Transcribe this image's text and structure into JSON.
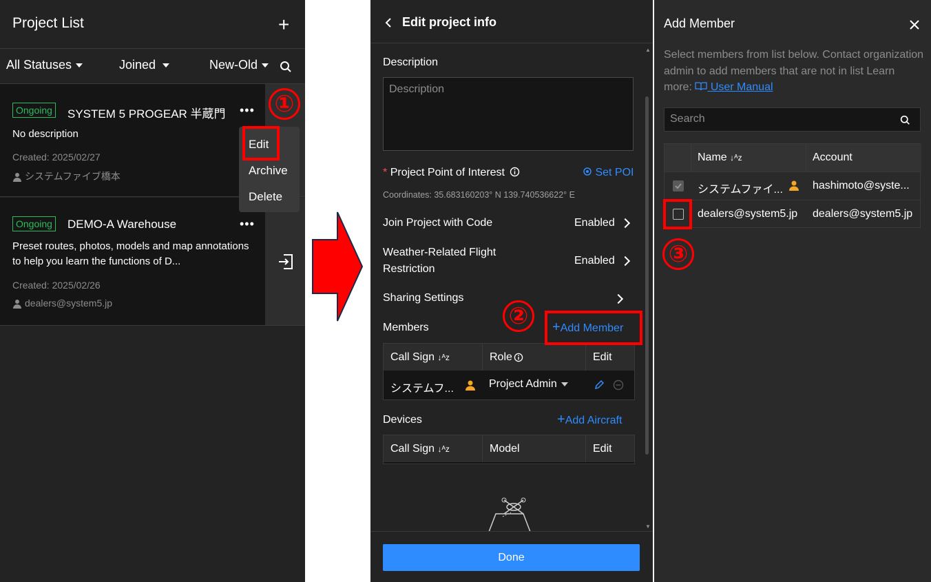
{
  "left_panel": {
    "title": "Project List",
    "filters": {
      "status": "All Statuses",
      "joined": "Joined",
      "sort": "New-Old"
    },
    "projects": [
      {
        "status": "Ongoing",
        "name": "SYSTEM 5 PROGEAR 半蔵門",
        "description": "No description",
        "created": "Created: 2025/02/27",
        "owner": "システムファイブ橋本"
      },
      {
        "status": "Ongoing",
        "name": "DEMO-A Warehouse",
        "description": "Preset routes, photos, models and map annotations to help you learn the functions of D...",
        "created": "Created: 2025/02/26",
        "owner": "dealers@system5.jp"
      }
    ],
    "context_menu": [
      "Edit",
      "Archive",
      "Delete"
    ]
  },
  "annotations": {
    "step1": "①",
    "step2": "②",
    "step3": "③"
  },
  "edit_panel": {
    "title": "Edit project info",
    "description_label": "Description",
    "description_placeholder": "Description",
    "poi_required": "*",
    "poi_label": "Project Point of Interest",
    "set_poi": "Set POI",
    "coordinates": "Coordinates: 35.683160203° N 139.740536622° E",
    "join_code_label": "Join Project with Code",
    "join_code_value": "Enabled",
    "weather_label_1": "Weather-Related Flight",
    "weather_label_2": "Restriction",
    "weather_value": "Enabled",
    "sharing_label": "Sharing Settings",
    "members_label": "Members",
    "add_member": "Add Member",
    "members_table": {
      "headers": [
        "Call Sign",
        "Role",
        "Edit"
      ],
      "rows": [
        {
          "call_sign": "システムフ...",
          "role": "Project Admin"
        }
      ]
    },
    "devices_label": "Devices",
    "add_aircraft": "Add Aircraft",
    "devices_table": {
      "headers": [
        "Call Sign",
        "Model",
        "Edit"
      ]
    },
    "done": "Done"
  },
  "add_member_panel": {
    "title": "Add Member",
    "instruction": "Select members from list below. Contact organization admin to add members that are not in list Learn more:",
    "manual_link": "User Manual",
    "search_placeholder": "Search",
    "headers": [
      "Name",
      "Account"
    ],
    "rows": [
      {
        "name": "システムファイ...",
        "account": "hashimoto@syste...",
        "checked": true,
        "disabled": true
      },
      {
        "name": "dealers@system5.jp",
        "account": "dealers@system5.jp",
        "checked": false,
        "disabled": false
      }
    ]
  },
  "colors": {
    "accent": "#2f8cff",
    "ongoing": "#2dbb5c",
    "annotation": "#ff0000",
    "admin_icon": "#f5a623"
  }
}
